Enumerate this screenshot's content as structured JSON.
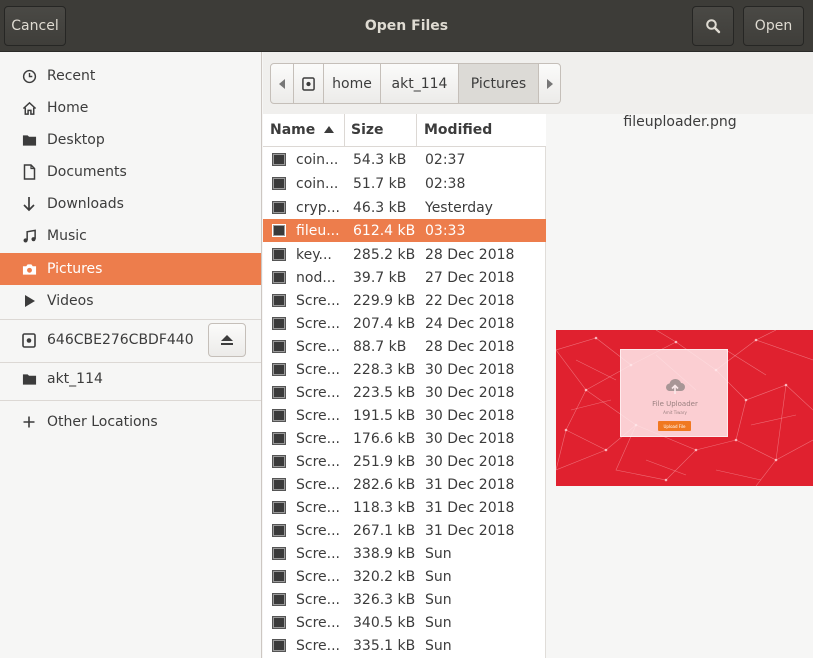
{
  "header": {
    "title": "Open Files",
    "cancel_label": "Cancel",
    "open_label": "Open",
    "search_icon": "search-icon"
  },
  "sidebar": {
    "items": [
      {
        "label": "Recent",
        "icon": "clock-icon"
      },
      {
        "label": "Home",
        "icon": "home-icon"
      },
      {
        "label": "Desktop",
        "icon": "folder-icon"
      },
      {
        "label": "Documents",
        "icon": "document-icon"
      },
      {
        "label": "Downloads",
        "icon": "download-arrow-icon"
      },
      {
        "label": "Music",
        "icon": "music-icon"
      },
      {
        "label": "Pictures",
        "icon": "camera-icon"
      },
      {
        "label": "Videos",
        "icon": "video-icon"
      }
    ],
    "drive": {
      "label": "646CBE276CBDF440",
      "icon": "drive-icon",
      "eject_icon": "eject-icon"
    },
    "bookmark": {
      "label": "akt_114",
      "icon": "folder-icon"
    },
    "other": {
      "label": "Other Locations",
      "icon": "plus-icon"
    },
    "active_index": 6
  },
  "pathbar": {
    "segments": [
      "home",
      "akt_114",
      "Pictures"
    ],
    "current": "Pictures"
  },
  "filelist": {
    "columns": {
      "name": "Name",
      "size": "Size",
      "modified": "Modified"
    },
    "sort": "Name ascending",
    "rows": [
      {
        "name": "coin...",
        "size": "54.3 kB",
        "modified": "02:37"
      },
      {
        "name": "coin...",
        "size": "51.7 kB",
        "modified": "02:38"
      },
      {
        "name": "cryp...",
        "size": "46.3 kB",
        "modified": "Yesterday"
      },
      {
        "name": "fileu...",
        "size": "612.4 kB",
        "modified": "03:33",
        "selected": true
      },
      {
        "name": "key...",
        "size": "285.2 kB",
        "modified": "28 Dec 2018"
      },
      {
        "name": "nod...",
        "size": "39.7 kB",
        "modified": "27 Dec 2018"
      },
      {
        "name": "Scre...",
        "size": "229.9 kB",
        "modified": "22 Dec 2018"
      },
      {
        "name": "Scre...",
        "size": "207.4 kB",
        "modified": "24 Dec 2018"
      },
      {
        "name": "Scre...",
        "size": "88.7 kB",
        "modified": "28 Dec 2018"
      },
      {
        "name": "Scre...",
        "size": "228.3 kB",
        "modified": "30 Dec 2018"
      },
      {
        "name": "Scre...",
        "size": "223.5 kB",
        "modified": "30 Dec 2018"
      },
      {
        "name": "Scre...",
        "size": "191.5 kB",
        "modified": "30 Dec 2018"
      },
      {
        "name": "Scre...",
        "size": "176.6 kB",
        "modified": "30 Dec 2018"
      },
      {
        "name": "Scre...",
        "size": "251.9 kB",
        "modified": "30 Dec 2018"
      },
      {
        "name": "Scre...",
        "size": "282.6 kB",
        "modified": "31 Dec 2018"
      },
      {
        "name": "Scre...",
        "size": "118.3 kB",
        "modified": "31 Dec 2018"
      },
      {
        "name": "Scre...",
        "size": "267.1 kB",
        "modified": "31 Dec 2018"
      },
      {
        "name": "Scre...",
        "size": "338.9 kB",
        "modified": "Sun"
      },
      {
        "name": "Scre...",
        "size": "320.2 kB",
        "modified": "Sun"
      },
      {
        "name": "Scre...",
        "size": "326.3 kB",
        "modified": "Sun"
      },
      {
        "name": "Scre...",
        "size": "340.5 kB",
        "modified": "Sun"
      },
      {
        "name": "Scre...",
        "size": "335.1 kB",
        "modified": "Sun"
      }
    ]
  },
  "preview": {
    "filename": "fileuploader.png",
    "thumb_title": "File Uploader",
    "thumb_subtitle": "Amit Tiwary",
    "thumb_button": "Upload File"
  },
  "colors": {
    "accent": "#ed7d4c",
    "headerbar": "#3d3c38",
    "thumb_bg": "#e0212f"
  }
}
